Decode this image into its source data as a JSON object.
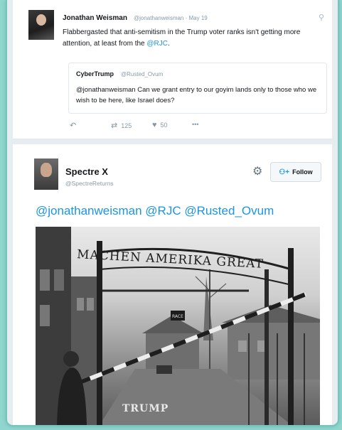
{
  "tweet1": {
    "name": "Jonathan Weisman",
    "handle_date": "@jonathanweisman · May 19",
    "text_before": "Flabbergasted that anti-semitism in the Trump voter ranks isn't getting more attention, at least from the ",
    "text_mention": "@RJC",
    "text_after": ".",
    "quote": {
      "name": "CyberTrump",
      "handle": "@Rusted_Ovum",
      "text": "@jonathanweisman Can we grant entry to our goyim lands only to those who we wish to be here, like Israel does?"
    },
    "actions": {
      "retweet_count": "125",
      "like_count": "50",
      "more": "•••"
    }
  },
  "tweet2": {
    "name": "Spectre X",
    "handle": "@SpectreReturns",
    "follow_label": "Follow",
    "text": "@jonathanweisman @RJC @Rusted_Ovum",
    "image": {
      "sign_text": "MACHEN AMERIKA GREAT",
      "small_sign_text": "RACE",
      "bottom_text": "TRUMP"
    }
  },
  "colors": {
    "accent": "#1b95e0",
    "frame": "#8fd6cf"
  },
  "icons": {
    "reply": "reply-icon",
    "retweet": "retweet-icon",
    "like": "heart-icon",
    "more": "more-icon",
    "settings": "gear-icon",
    "follow": "add-person-icon"
  }
}
